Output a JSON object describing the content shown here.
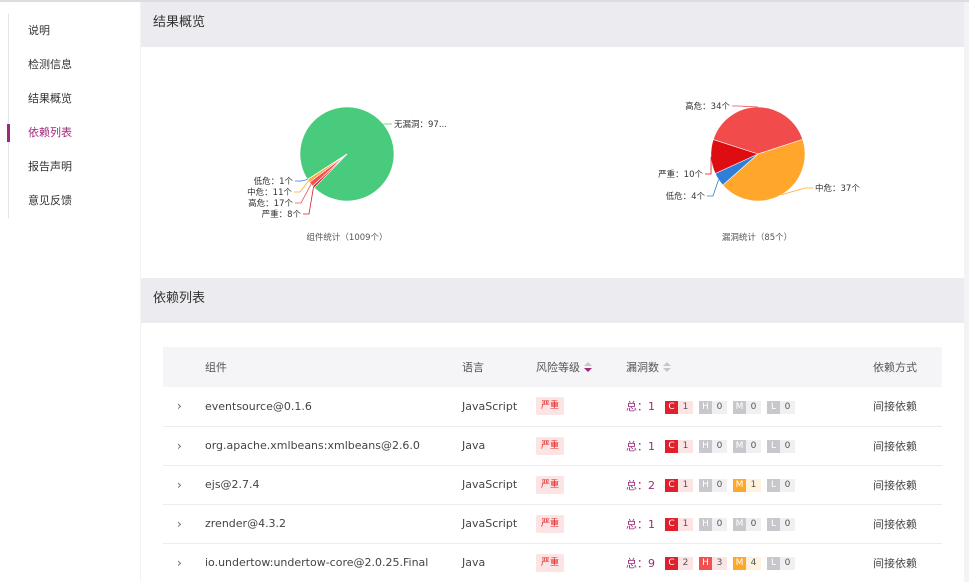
{
  "sidebar": {
    "items": [
      {
        "label": "说明",
        "active": false
      },
      {
        "label": "检测信息",
        "active": false
      },
      {
        "label": "结果概览",
        "active": false
      },
      {
        "label": "依赖列表",
        "active": true
      },
      {
        "label": "报告声明",
        "active": false
      },
      {
        "label": "意见反馈",
        "active": false
      }
    ]
  },
  "overview": {
    "title": "结果概览"
  },
  "deps_section": {
    "title": "依赖列表"
  },
  "colors": {
    "accent": "#a0287a",
    "critical": "#e0202c",
    "high": "#f05050",
    "medium": "#ffa726",
    "low": "#c8c8cc"
  },
  "chart_data": [
    {
      "type": "pie",
      "title": "组件统计（1009个）",
      "slices": [
        {
          "name": "无漏洞",
          "label": "无漏洞：97...",
          "value": 972,
          "color": "#48cb7c"
        },
        {
          "name": "严重",
          "label": "严重：8个",
          "value": 8,
          "color": "#e11d2a"
        },
        {
          "name": "高危",
          "label": "高危：17个",
          "value": 17,
          "color": "#f25151"
        },
        {
          "name": "中危",
          "label": "中危：11个",
          "value": 11,
          "color": "#ffa62b"
        },
        {
          "name": "低危",
          "label": "低危：1个",
          "value": 1,
          "color": "#2f7ed8"
        }
      ]
    },
    {
      "type": "pie",
      "title": "漏洞统计（85个）",
      "slices": [
        {
          "name": "高危",
          "label": "高危：34个",
          "value": 34,
          "color": "#f24b4b"
        },
        {
          "name": "中危",
          "label": "中危：37个",
          "value": 37,
          "color": "#ffa62b"
        },
        {
          "name": "低危",
          "label": "低危：4个",
          "value": 4,
          "color": "#2f7ed8"
        },
        {
          "name": "严重",
          "label": "严重：10个",
          "value": 10,
          "color": "#dd0d12"
        }
      ]
    }
  ],
  "table": {
    "headers": {
      "component": "组件",
      "language": "语言",
      "risk": "风险等级",
      "vuln": "漏洞数",
      "dep": "依赖方式"
    },
    "total_prefix": "总：",
    "rows": [
      {
        "component": "eventsource@0.1.6",
        "language": "JavaScript",
        "risk": "严重",
        "total": "1",
        "sev": [
          {
            "k": "C",
            "n": "1"
          },
          {
            "k": "H",
            "n": "0"
          },
          {
            "k": "M",
            "n": "0"
          },
          {
            "k": "L",
            "n": "0"
          }
        ],
        "dep": "间接依赖"
      },
      {
        "component": "org.apache.xmlbeans:xmlbeans@2.6.0",
        "language": "Java",
        "risk": "严重",
        "total": "1",
        "sev": [
          {
            "k": "C",
            "n": "1"
          },
          {
            "k": "H",
            "n": "0"
          },
          {
            "k": "M",
            "n": "0"
          },
          {
            "k": "L",
            "n": "0"
          }
        ],
        "dep": "间接依赖"
      },
      {
        "component": "ejs@2.7.4",
        "language": "JavaScript",
        "risk": "严重",
        "total": "2",
        "sev": [
          {
            "k": "C",
            "n": "1"
          },
          {
            "k": "H",
            "n": "0"
          },
          {
            "k": "M",
            "n": "1"
          },
          {
            "k": "L",
            "n": "0"
          }
        ],
        "dep": "间接依赖"
      },
      {
        "component": "zrender@4.3.2",
        "language": "JavaScript",
        "risk": "严重",
        "total": "1",
        "sev": [
          {
            "k": "C",
            "n": "1"
          },
          {
            "k": "H",
            "n": "0"
          },
          {
            "k": "M",
            "n": "0"
          },
          {
            "k": "L",
            "n": "0"
          }
        ],
        "dep": "间接依赖"
      },
      {
        "component": "io.undertow:undertow-core@2.0.25.Final",
        "language": "Java",
        "risk": "严重",
        "total": "9",
        "sev": [
          {
            "k": "C",
            "n": "2"
          },
          {
            "k": "H",
            "n": "3"
          },
          {
            "k": "M",
            "n": "4"
          },
          {
            "k": "L",
            "n": "0"
          }
        ],
        "dep": "间接依赖"
      }
    ]
  }
}
